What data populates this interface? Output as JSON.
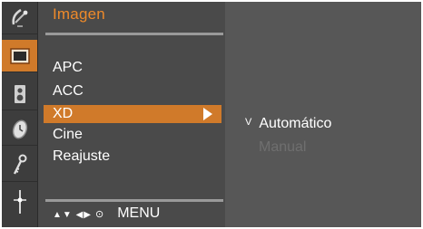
{
  "menu": {
    "title": "Imagen",
    "items": [
      {
        "label": "APC"
      },
      {
        "label": "ACC"
      },
      {
        "label": "XD"
      },
      {
        "label": "Cine"
      },
      {
        "label": "Reajuste"
      }
    ],
    "selected_item": "XD",
    "nav_hint": {
      "glyphs": "▲▼ ◀▶",
      "ok_glyph": "⊙",
      "menu_label": "MENU"
    }
  },
  "submenu": {
    "options": [
      {
        "label": "Automático",
        "mark": "V",
        "state": "current"
      },
      {
        "label": "Manual",
        "state": "disabled"
      }
    ]
  },
  "icons": [
    "satellite-dish-icon",
    "picture-icon",
    "speaker-icon",
    "clock-icon",
    "key-icon",
    "input-icon"
  ],
  "colors": {
    "accent": "#d07a2a",
    "title": "#ee8a2a",
    "panel": "#4a4a4a",
    "disabled_text": "#6f6f6f"
  }
}
